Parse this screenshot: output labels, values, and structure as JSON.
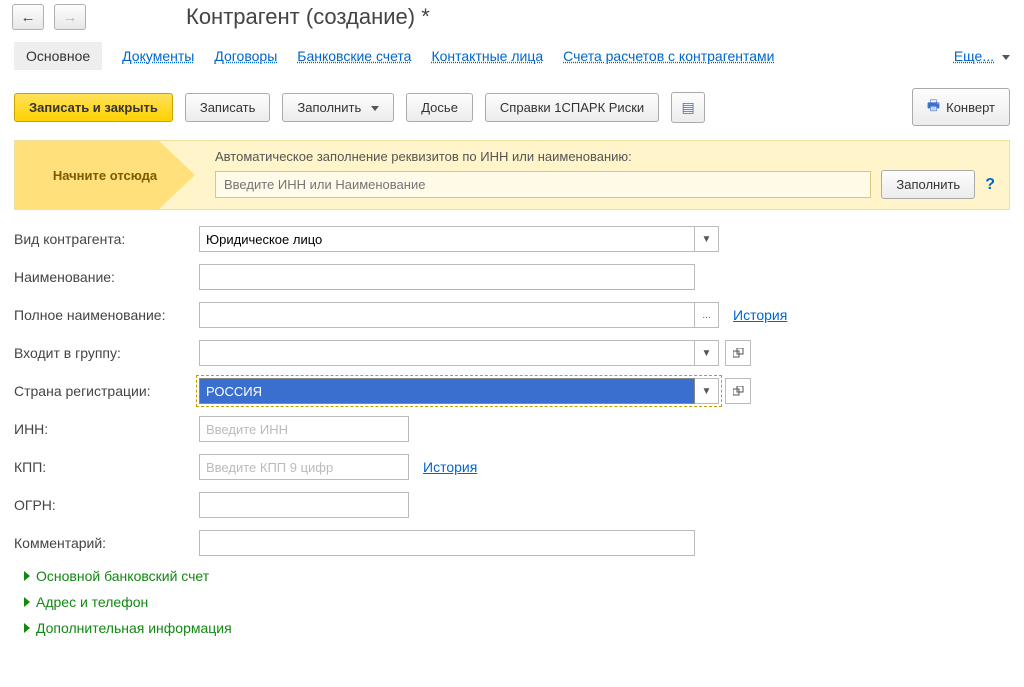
{
  "nav": {
    "back": "←",
    "forward": "→"
  },
  "title": "Контрагент (создание) *",
  "tabs": {
    "main": "Основное",
    "items": [
      "Документы",
      "Договоры",
      "Банковские счета",
      "Контактные лица",
      "Счета расчетов с контрагентами"
    ],
    "more": "Еще..."
  },
  "toolbar": {
    "save_close": "Записать и закрыть",
    "save": "Записать",
    "fill": "Заполнить",
    "dossier": "Досье",
    "spark": "Справки 1СПАРК Риски",
    "convert": "Конверт"
  },
  "banner": {
    "start": "Начните отсюда",
    "label": "Автоматическое заполнение реквизитов по ИНН или наименованию:",
    "placeholder": "Введите ИНН или Наименование",
    "fill_btn": "Заполнить",
    "help": "?"
  },
  "fields": {
    "type_label": "Вид контрагента:",
    "type_value": "Юридическое лицо",
    "name_label": "Наименование:",
    "name_value": "",
    "fullname_label": "Полное наименование:",
    "fullname_value": "",
    "history": "История",
    "group_label": "Входит в группу:",
    "group_value": "",
    "country_label": "Страна регистрации:",
    "country_value": "РОССИЯ",
    "inn_label": "ИНН:",
    "inn_placeholder": "Введите ИНН",
    "kpp_label": "КПП:",
    "kpp_placeholder": "Введите КПП 9 цифр",
    "ogrn_label": "ОГРН:",
    "comment_label": "Комментарий:"
  },
  "sections": {
    "bank": "Основной банковский счет",
    "address": "Адрес и телефон",
    "extra": "Дополнительная информация"
  }
}
